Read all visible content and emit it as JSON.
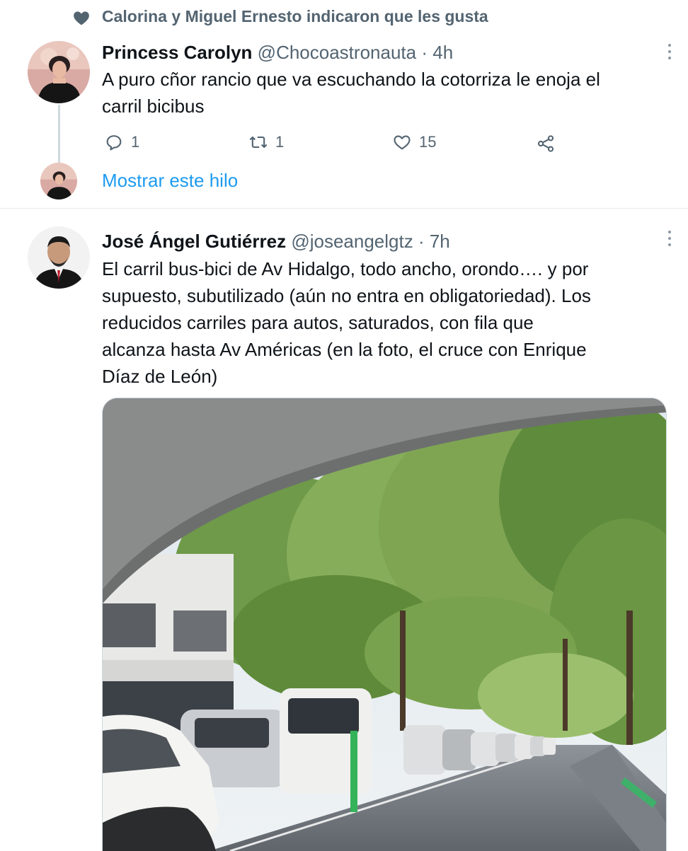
{
  "social_context": {
    "text": "Calorina y Miguel Ernesto indicaron que les gusta",
    "icon": "heart-filled-icon"
  },
  "tweet1": {
    "name": "Princess Carolyn",
    "handle": "@Chocoastronauta",
    "separator": "·",
    "time": "4h",
    "text_lines": [
      "A puro cñor rancio que va escuchando la cotorriza le enoja el",
      "carril bicibus"
    ],
    "actions": {
      "reply_count": "1",
      "retweet_count": "1",
      "like_count": "15"
    },
    "show_thread": "Mostrar este hilo"
  },
  "tweet2": {
    "name": "José Ángel Gutiérrez",
    "handle": "@joseangelgtz",
    "separator": "·",
    "time": "7h",
    "text_lines": [
      "El carril bus-bici de Av Hidalgo, todo ancho, orondo…. y por",
      "supuesto, subutilizado (aún no entra en obligatoriedad). Los",
      "reducidos carriles para autos, saturados, con fila que",
      "alcanza hasta Av Américas (en la foto, el cruce con Enrique",
      "Díaz de León)"
    ]
  },
  "colors": {
    "accent": "#1d9bf0",
    "secondary_text": "#536471",
    "primary_text": "#0f1419"
  }
}
